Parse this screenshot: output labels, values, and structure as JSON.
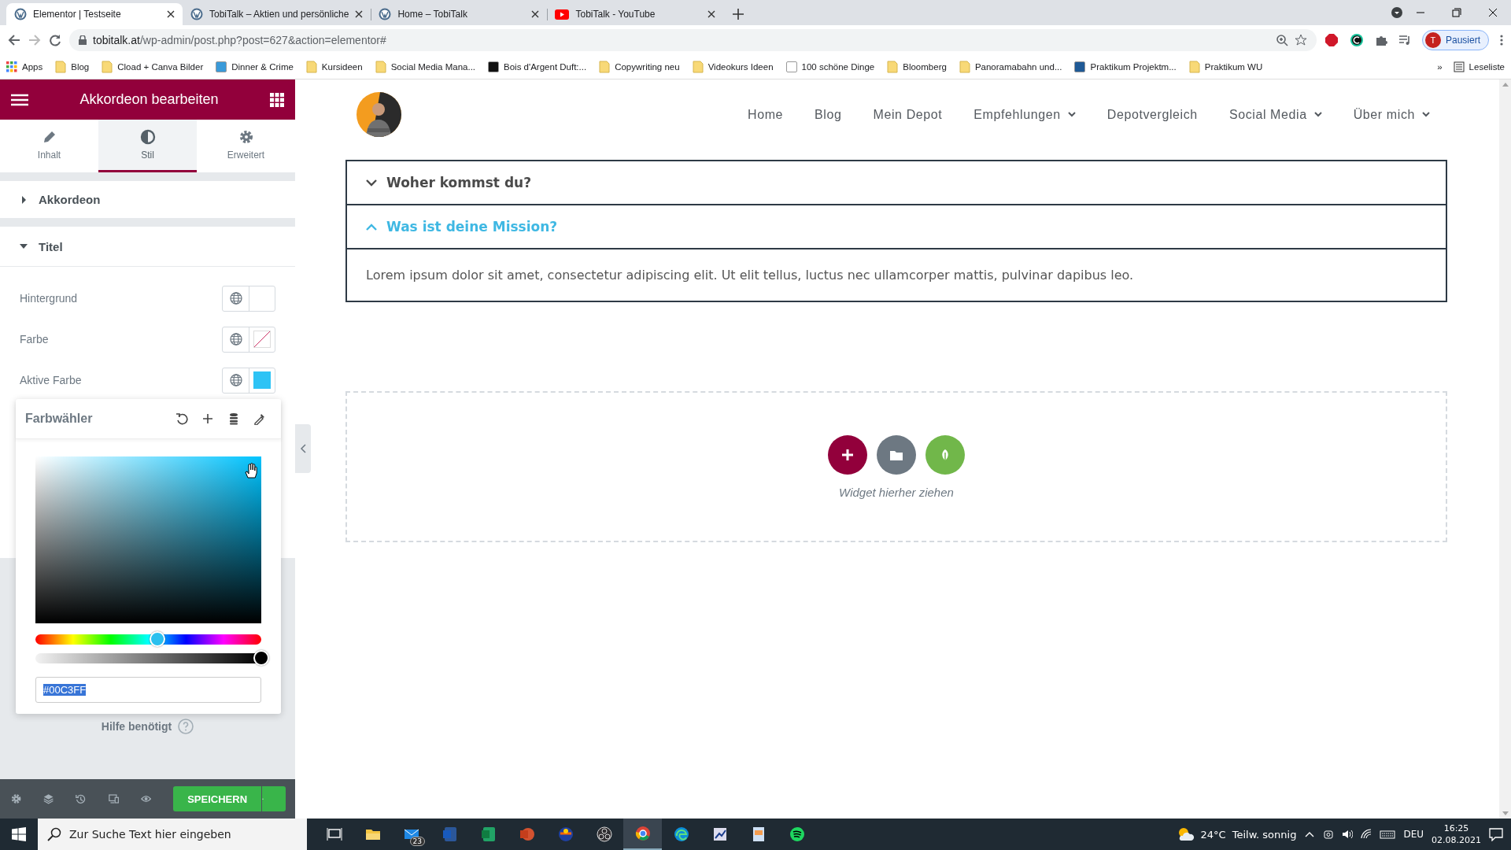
{
  "browser": {
    "tabs": [
      {
        "title": "Elementor | Testseite",
        "selected": true,
        "kind": "wordpress"
      },
      {
        "title": "TobiTalk – Aktien und persönliche",
        "selected": false,
        "kind": "wordpress"
      },
      {
        "title": "Home – TobiTalk",
        "selected": false,
        "kind": "wordpress"
      },
      {
        "title": "TobiTalk - YouTube",
        "selected": false,
        "kind": "youtube"
      }
    ],
    "url_host": "tobitalk.at",
    "url_path": "/wp-admin/post.php?post=627&action=elementor#",
    "profile_initial": "T",
    "profile_label": "Pausiert",
    "bookmarks": [
      {
        "label": "Apps",
        "kind": "apps"
      },
      {
        "label": "Blog",
        "kind": "folder"
      },
      {
        "label": "Cload + Canva Bilder",
        "kind": "folder"
      },
      {
        "label": "Dinner & Crime",
        "kind": "favicon",
        "color": "#3a9ad9"
      },
      {
        "label": "Kursideen",
        "kind": "folder"
      },
      {
        "label": "Social Media Mana...",
        "kind": "folder"
      },
      {
        "label": "Bois d'Argent Duft:...",
        "kind": "favicon",
        "color": "#111111"
      },
      {
        "label": "Copywriting neu",
        "kind": "folder"
      },
      {
        "label": "Videokurs Ideen",
        "kind": "folder"
      },
      {
        "label": "100 schöne Dinge",
        "kind": "favicon",
        "color": "#ffffff"
      },
      {
        "label": "Bloomberg",
        "kind": "folder"
      },
      {
        "label": "Panoramabahn und...",
        "kind": "folder"
      },
      {
        "label": "Praktikum Projektm...",
        "kind": "favicon",
        "color": "#1f5a96"
      },
      {
        "label": "Praktikum WU",
        "kind": "folder"
      }
    ],
    "more": "»",
    "reading_list": "Leseliste"
  },
  "editor": {
    "title": "Akkordeon bearbeiten",
    "tabs": [
      {
        "label": "Inhalt",
        "kind": "pencil",
        "selected": false
      },
      {
        "label": "Stil",
        "kind": "contrast",
        "selected": true
      },
      {
        "label": "Erweitert",
        "kind": "gear",
        "selected": false
      }
    ],
    "sections": [
      {
        "title": "Akkordeon",
        "expanded": false
      },
      {
        "title": "Titel",
        "expanded": true
      }
    ],
    "controls": [
      {
        "label": "Hintergrund",
        "kind": "empty"
      },
      {
        "label": "Farbe",
        "kind": "unset"
      },
      {
        "label": "Aktive Farbe",
        "kind": "color",
        "color": "#2ec3f5"
      }
    ],
    "color_picker": {
      "title": "Farbwähler",
      "hue": {
        "level": 0.54
      },
      "alpha": {
        "level": 1
      },
      "value": "#00C3FF"
    },
    "help": "Hilfe benötigt",
    "save": "SPEICHERN"
  },
  "site": {
    "nav": [
      {
        "label": "Home",
        "dropdown": false
      },
      {
        "label": "Blog",
        "dropdown": false
      },
      {
        "label": "Mein Depot",
        "dropdown": false
      },
      {
        "label": "Empfehlungen",
        "dropdown": true
      },
      {
        "label": "Depotvergleich",
        "dropdown": false
      },
      {
        "label": "Social Media",
        "dropdown": true
      },
      {
        "label": "Über mich",
        "dropdown": true
      }
    ],
    "accordion": [
      {
        "title": "Woher kommst du?",
        "expanded": false
      },
      {
        "title": "Was ist deine Mission?",
        "expanded": true,
        "body": "Lorem ipsum dolor sit amet, consectetur adipiscing elit. Ut elit tellus, luctus nec ullamcorper mattis, pulvinar dapibus leo."
      }
    ],
    "dropzone": "Widget hierher ziehen"
  },
  "taskbar": {
    "search_placeholder": "Zur Suche Text hier eingeben",
    "apps": [
      {
        "kind": "taskview",
        "active": false
      },
      {
        "kind": "explorer",
        "active": false
      },
      {
        "kind": "mail",
        "active": false,
        "badge": "23"
      },
      {
        "kind": "word",
        "active": false
      },
      {
        "kind": "excel",
        "active": false
      },
      {
        "kind": "powerpoint",
        "active": false
      },
      {
        "kind": "globe",
        "active": false
      },
      {
        "kind": "obs",
        "active": false
      },
      {
        "kind": "chrome",
        "active": true
      },
      {
        "kind": "edge",
        "active": false
      },
      {
        "kind": "tool",
        "active": false
      },
      {
        "kind": "doc",
        "active": false
      },
      {
        "kind": "spotify",
        "active": false
      }
    ],
    "temperature": "24°C",
    "weather": "Teilw. sonnig",
    "language": "DEU",
    "time": "16:25",
    "date": "02.08.2021"
  }
}
